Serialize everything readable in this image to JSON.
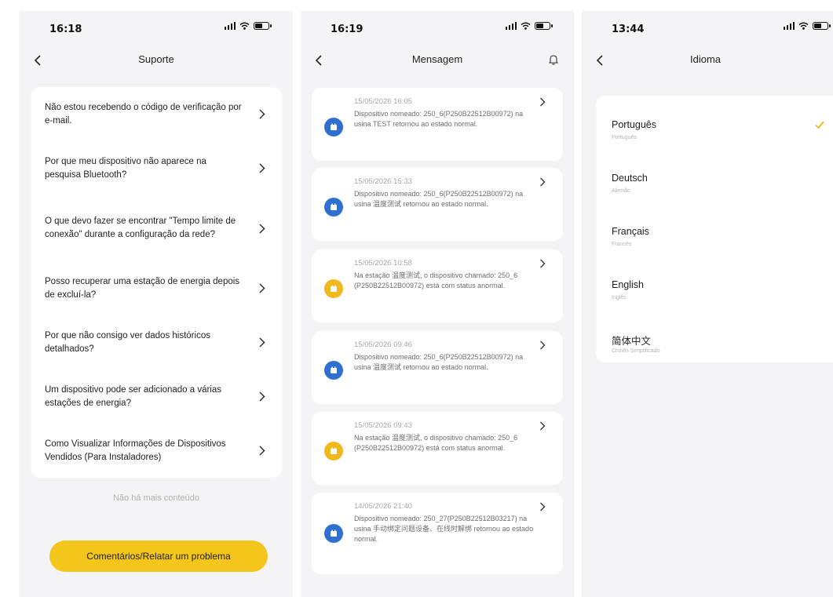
{
  "accent_color": "#f4c51a",
  "support": {
    "status_time": "16:18",
    "title": "Suporte",
    "faq": [
      "Não estou recebendo o código de verificação por e-mail.",
      "Por que meu dispositivo não aparece na pesquisa Bluetooth?",
      "O que devo fazer se encontrar \"Tempo limite de conexão\" durante a configuração da rede?",
      "Posso recuperar uma estação de energia depois de excluí-la?",
      "Por que não consigo ver dados históricos detalhados?",
      "Um dispositivo pode ser adicionado a várias estações de energia?",
      "Como Visualizar Informações de Dispositivos Vendidos (Para Instaladores)"
    ],
    "no_more": "Não há mais conteúdo",
    "feedback_button": "Comentários/Relatar um problema"
  },
  "messages": {
    "status_time": "16:19",
    "title": "Mensagem",
    "items": [
      {
        "date": "15/05/2026 16:05",
        "text": "Dispositivo nomeado: 250_6(P250B22512B00972) na usina TEST retornou ao estado normal.",
        "status": "normal",
        "icon": "device-icon"
      },
      {
        "date": "15/05/2026 15:33",
        "text": "Dispositivo nomeado: 250_6(P250B22512B00972) na usina 温度测试 retornou ao estado normal.",
        "status": "normal",
        "icon": "device-icon"
      },
      {
        "date": "15/05/2026 10:58",
        "text": "Na estação 温度测试, o dispositivo chamado: 250_6 (P250B22512B00972) está com status anormal.",
        "status": "abnormal",
        "icon": "device-icon"
      },
      {
        "date": "15/05/2026 09:46",
        "text": "Dispositivo nomeado: 250_6(P250B22512B00972) na usina 温度测试 retornou ao estado normal.",
        "status": "normal",
        "icon": "device-icon"
      },
      {
        "date": "15/05/2026 09:43",
        "text": "Na estação 温度测试, o dispositivo chamado: 250_6 (P250B22512B00972) está com status anormal.",
        "status": "abnormal",
        "icon": "device-icon"
      },
      {
        "date": "14/05/2026 21:40",
        "text": "Dispositivo nomeado: 250_27(P250B22512B03217) na usina 手动绑定问题设备、在线时解绑 retornou ao estado normal.",
        "status": "normal",
        "icon": "device-icon"
      }
    ]
  },
  "language": {
    "status_time": "13:44",
    "title": "Idioma",
    "items": [
      {
        "name": "Português",
        "sub": "Português",
        "selected": true
      },
      {
        "name": "Deutsch",
        "sub": "Alemão",
        "selected": false
      },
      {
        "name": "Français",
        "sub": "Francês",
        "selected": false
      },
      {
        "name": "English",
        "sub": "Inglês",
        "selected": false
      },
      {
        "name": "简体中文",
        "sub": "Chinês Simplificado",
        "selected": false
      }
    ]
  }
}
